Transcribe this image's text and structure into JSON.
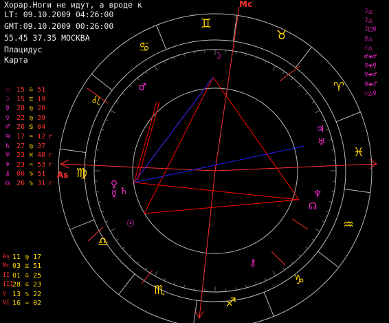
{
  "header": {
    "title": "Хорар.Ноги не идут, а вроде к",
    "lt": "LT: 09.10.2009 04:26:00",
    "gmt": "GMT:09.10.2009 00:26:00",
    "coords": "55.45 37.35 МОСКВА",
    "system": "Плацидус",
    "mode": "Карта"
  },
  "planets": [
    {
      "glyph": "☉",
      "glyph_color": "#ff2bd6",
      "deg": "15",
      "sign": "♎",
      "min": "51",
      "retro": ""
    },
    {
      "glyph": "☽",
      "glyph_color": "#ff2bd6",
      "deg": "15",
      "sign": "♊",
      "min": "19",
      "retro": ""
    },
    {
      "glyph": "☿",
      "glyph_color": "#ff2bd6",
      "deg": "28",
      "sign": "♍",
      "min": "28",
      "retro": ""
    },
    {
      "glyph": "♀",
      "glyph_color": "#ff2bd6",
      "deg": "22",
      "sign": "♍",
      "min": "39",
      "retro": ""
    },
    {
      "glyph": "♂",
      "glyph_color": "#ff2bd6",
      "deg": "26",
      "sign": "♋",
      "min": "04",
      "retro": ""
    },
    {
      "glyph": "♃",
      "glyph_color": "#ff2bd6",
      "deg": "17",
      "sign": "♒",
      "min": "12",
      "retro": "r"
    },
    {
      "glyph": "♄",
      "glyph_color": "#ff2bd6",
      "deg": "27",
      "sign": "♍",
      "min": "37",
      "retro": ""
    },
    {
      "glyph": "♅",
      "glyph_color": "#ff2bd6",
      "deg": "23",
      "sign": "♓",
      "min": "48",
      "retro": "r"
    },
    {
      "glyph": "♆",
      "glyph_color": "#ff2bd6",
      "deg": "23",
      "sign": "♒",
      "min": "53",
      "retro": "r"
    },
    {
      "glyph": "⚷",
      "glyph_color": "#ff2bd6",
      "deg": "00",
      "sign": "♑",
      "min": "51",
      "retro": ""
    },
    {
      "glyph": "☊",
      "glyph_color": "#ff2bd6",
      "deg": "26",
      "sign": "♑",
      "min": "31",
      "retro": "r"
    }
  ],
  "cusps": [
    {
      "label": "As",
      "deg": "11",
      "sign": "♍",
      "min": "17"
    },
    {
      "label": "Mc",
      "deg": "03",
      "sign": "♊",
      "min": "51"
    },
    {
      "label": "II",
      "deg": "01",
      "sign": "♎",
      "min": "25"
    },
    {
      "label": "III",
      "deg": "28",
      "sign": "♎",
      "min": "23"
    },
    {
      "label": "V",
      "deg": "13",
      "sign": "♑",
      "min": "22"
    },
    {
      "label": "VI",
      "deg": "16",
      "sign": "♒",
      "min": "02"
    }
  ],
  "aspects_table": [
    "☽△",
    "☽△",
    "☽□♀",
    "♀△",
    "☉△",
    "♂⚹♂",
    "♀⚹☿",
    "♀⚹♂",
    "♀⚹♂",
    "☉△♀"
  ],
  "wheel": {
    "asc_label": "As",
    "mc_label": "Mc",
    "colors": {
      "signs": "#ffd700",
      "planets": "#ff2bd6",
      "axes": "#ff3030",
      "aspect_red": "#ff0000",
      "aspect_blue": "#2020ff",
      "rings": "#bbbbbb"
    },
    "zodiac": [
      {
        "glyph": "♊",
        "name": "gemini-icon"
      },
      {
        "glyph": "♉",
        "name": "taurus-icon"
      },
      {
        "glyph": "♈",
        "name": "aries-icon"
      },
      {
        "glyph": "♓",
        "name": "pisces-icon"
      },
      {
        "glyph": "♒",
        "name": "aquarius-icon"
      },
      {
        "glyph": "♑",
        "name": "capricorn-icon"
      },
      {
        "glyph": "♐",
        "name": "sagittarius-icon"
      },
      {
        "glyph": "♏",
        "name": "scorpio-icon"
      },
      {
        "glyph": "♎",
        "name": "libra-icon"
      },
      {
        "glyph": "♍",
        "name": "virgo-icon"
      },
      {
        "glyph": "♌",
        "name": "leo-icon"
      },
      {
        "glyph": "♋",
        "name": "cancer-icon"
      }
    ],
    "planet_marks": [
      {
        "glyph": "☽",
        "name": "moon-icon"
      },
      {
        "glyph": "♂",
        "name": "mars-icon"
      },
      {
        "glyph": "♅",
        "name": "uranus-icon"
      },
      {
        "glyph": "♃",
        "name": "jupiter-icon"
      },
      {
        "glyph": "♆",
        "name": "neptune-icon"
      },
      {
        "glyph": "☊",
        "name": "node-icon"
      },
      {
        "glyph": "⚷",
        "name": "chiron-icon"
      },
      {
        "glyph": "♀",
        "name": "venus-icon"
      },
      {
        "glyph": "♄",
        "name": "saturn-icon"
      },
      {
        "glyph": "☿",
        "name": "mercury-icon"
      },
      {
        "glyph": "☉",
        "name": "sun-icon"
      }
    ]
  }
}
